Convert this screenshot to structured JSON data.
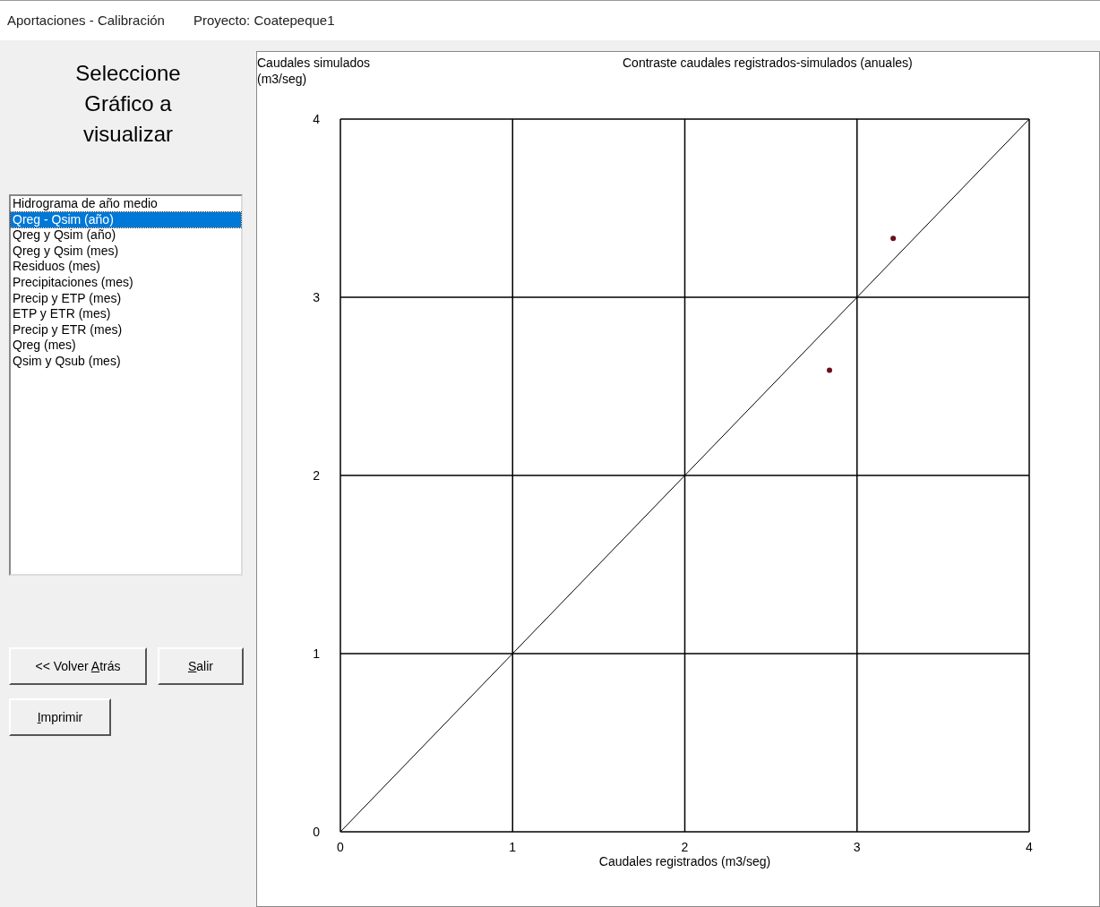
{
  "header": {
    "module": "Aportaciones - Calibración",
    "project": "Proyecto: Coatepeque1"
  },
  "sidebar": {
    "heading": "Seleccione Gráfico a visualizar",
    "list": [
      {
        "label": "Hidrograma de año medio",
        "selected": false
      },
      {
        "label": "Qreg - Qsim (año)",
        "selected": true
      },
      {
        "label": "Qreg y Qsim (año)",
        "selected": false
      },
      {
        "label": "Qreg y Qsim (mes)",
        "selected": false
      },
      {
        "label": "Residuos (mes)",
        "selected": false
      },
      {
        "label": "Precipitaciones (mes)",
        "selected": false
      },
      {
        "label": "Precip y ETP (mes)",
        "selected": false
      },
      {
        "label": "ETP y ETR (mes)",
        "selected": false
      },
      {
        "label": "Precip y ETR (mes)",
        "selected": false
      },
      {
        "label": "Qreg (mes)",
        "selected": false
      },
      {
        "label": "Qsim y Qsub (mes)",
        "selected": false
      }
    ],
    "buttons": [
      {
        "before": "<< Volver ",
        "key": "A",
        "after": "trás"
      },
      {
        "key": "S",
        "after": "alir"
      },
      {
        "key": "I",
        "after": "mprimir"
      }
    ]
  },
  "chart_data": {
    "type": "scatter",
    "title": "Contraste caudales registrados-simulados (anuales)",
    "xlabel": "Caudales registrados (m3/seg)",
    "ylabel": "Caudales simulados (m3/seg)",
    "x": [
      0,
      2.84,
      3.21,
      4
    ],
    "series": [
      {
        "type": "scatter",
        "color": "#6b0f1a",
        "values": [
          null,
          2.59,
          3.33,
          null
        ]
      },
      {
        "type": "line",
        "color": "#000000",
        "values": [
          0,
          2.84,
          3.21,
          4
        ]
      }
    ],
    "xlim": [
      0,
      4
    ],
    "ylim": [
      0,
      4
    ],
    "xticks": [
      0,
      1,
      2,
      3,
      4
    ],
    "yticks": [
      0,
      1,
      2,
      3,
      4
    ],
    "grid": true
  }
}
